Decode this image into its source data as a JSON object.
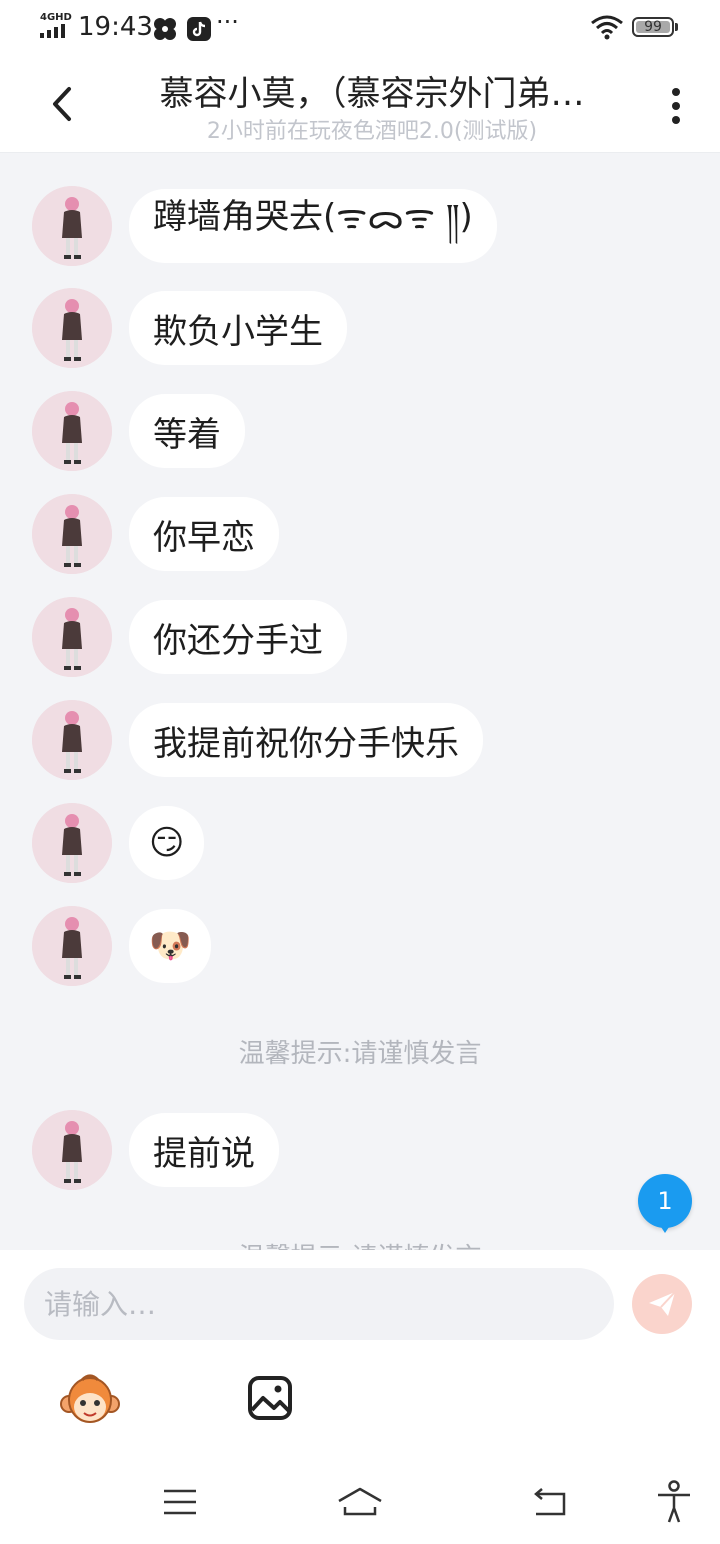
{
  "status_bar": {
    "network": "4GHD",
    "time": "19:43",
    "more": "···",
    "battery": "99",
    "battery_level": 0.99
  },
  "header": {
    "title": "慕容小莫，（慕容宗外门弟…",
    "subtitle": "2小时前在玩夜色酒吧2.0(测试版)"
  },
  "messages": [
    {
      "text": "蹲墙角哭去(ᯤᯅᯤ ༎)"
    },
    {
      "text": "欺负小学生"
    },
    {
      "text": "等着"
    },
    {
      "text": "你早恋"
    },
    {
      "text": "你还分手过"
    },
    {
      "text": "我提前祝你分手快乐"
    },
    {
      "text": "😏"
    },
    {
      "text": "🐶"
    },
    {
      "text": "提前说"
    }
  ],
  "tips": {
    "tip1": "温馨提示:请谨慎发言",
    "tip2": "温馨提示:请谨慎发言"
  },
  "unread_badge": "1",
  "composer": {
    "placeholder": "请输入…",
    "value": ""
  },
  "colors": {
    "accent_blue": "#1a9bf0",
    "send_button": "#fad4cc",
    "chat_background": "#f3f4f7"
  },
  "icons": {
    "back": "chevron-left-icon",
    "more": "more-vertical-icon",
    "send": "paper-plane-icon",
    "emoji": "monkey-emoji-icon",
    "image": "image-icon",
    "nav": [
      "menu-icon",
      "home-icon",
      "back-icon",
      "accessibility-icon"
    ]
  }
}
